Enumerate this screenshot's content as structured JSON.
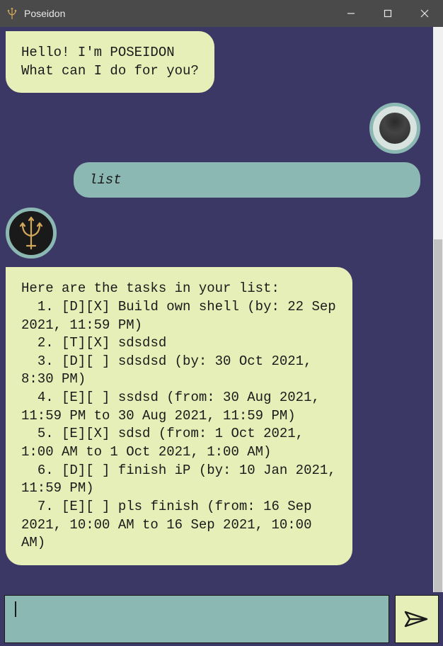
{
  "window": {
    "title": "Poseidon"
  },
  "messages": {
    "greeting": "Hello! I'm POSEIDON\nWhat can I do for you?",
    "user_cmd": "list",
    "task_list": "Here are the tasks in your list:\n  1. [D][X] Build own shell (by: 22 Sep 2021, 11:59 PM)\n  2. [T][X] sdsdsd\n  3. [D][ ] sdsdsd (by: 30 Oct 2021, 8:30 PM)\n  4. [E][ ] ssdsd (from: 30 Aug 2021, 11:59 PM to 30 Aug 2021, 11:59 PM)\n  5. [E][X] sdsd (from: 1 Oct 2021, 1:00 AM to 1 Oct 2021, 1:00 AM)\n  6. [D][ ] finish iP (by: 10 Jan 2021, 11:59 PM)\n  7. [E][ ] pls finish (from: 16 Sep 2021, 10:00 AM to 16 Sep 2021, 10:00 AM)"
  },
  "input": {
    "value": ""
  }
}
